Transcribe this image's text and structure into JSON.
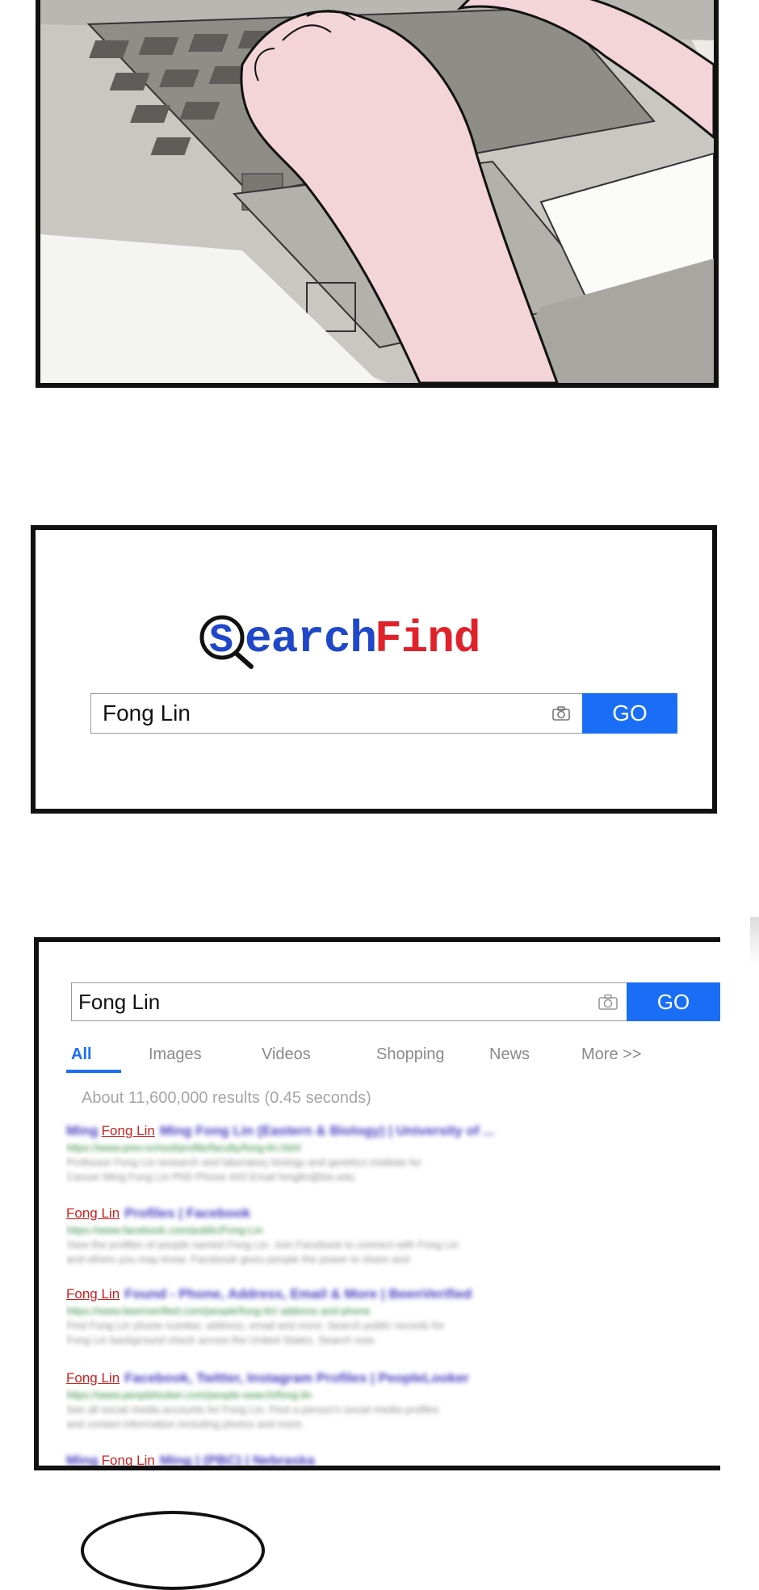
{
  "search_home": {
    "logo": {
      "first_letter": "S",
      "blue_part": "earch",
      "red_part": "Find"
    },
    "query": "Fong Lin",
    "camera_icon": "camera-icon",
    "go_label": "GO"
  },
  "results_page": {
    "query": "Fong Lin",
    "camera_icon": "camera-icon",
    "go_label": "GO",
    "tabs": [
      "All",
      "Images",
      "Videos",
      "Shopping",
      "News",
      "More >>"
    ],
    "active_tab": "All",
    "stats": "About 11,600,000 results (0.45 seconds)",
    "results": [
      {
        "name": "Fong Lin",
        "title_blur": "Ming Fong Lin (Eastern & Biology) | University of ...",
        "url_blur": "https://www.prev.school/profile/faculty/fong-lin.html",
        "snippet_blur": [
          "Professor Fong Lin research and laboratory biology and genetics institute for",
          "Cancer Ming Fong Lin PhD Phone 443 Email fonglin@bio.edu"
        ]
      },
      {
        "name": "Fong Lin",
        "title_blur": "Profiles | Facebook",
        "url_blur": "https://www.facebook.com/public/Fong-Lin",
        "snippet_blur": [
          "View the profiles of people named Fong Lin. Join Facebook to connect with Fong Lin",
          "and others you may know. Facebook gives people the power to share and"
        ]
      },
      {
        "name": "Fong Lin",
        "title_blur": "Found - Phone, Address, Email & More | BeenVerified",
        "url_blur": "https://www.beenverified.com/people/fong-lin/ address and phone",
        "snippet_blur": [
          "Find Fong Lin phone number, address, email and more. Search public records for",
          "Fong Lin background check across the United States. Search now."
        ]
      },
      {
        "name": "Fong Lin",
        "title_blur": "Facebook, Twitter, Instagram Profiles | PeopleLooker",
        "url_blur": "https://www.peoplelooker.com/people-search/fong-lin",
        "snippet_blur": [
          "See all social media accounts for Fong Lin. Find a person's social media profiles",
          "and contact information including photos and more."
        ]
      },
      {
        "name": "Fong Lin",
        "title_blur": "Ming | (PBC) | Nebraska",
        "url_blur": "",
        "snippet_blur": []
      }
    ]
  }
}
